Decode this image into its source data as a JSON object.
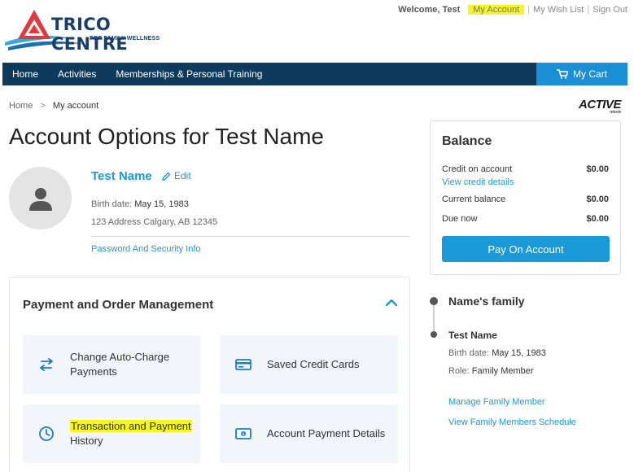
{
  "brand": {
    "name": "TRICO CENTRE",
    "tagline": "FOR FAMILY WELLNESS",
    "colors": {
      "navy": "#0e3a5c",
      "blue": "#1a9ad6",
      "red": "#e03a3e",
      "highlight": "#f5f522"
    }
  },
  "top_links": {
    "welcome": "Welcome, Test",
    "my_account": "My Account",
    "wish_list": "My Wish List",
    "sign_out": "Sign Out",
    "separator": "|"
  },
  "nav": {
    "home": "Home",
    "activities": "Activities",
    "memberships": "Memberships & Personal Training",
    "cart": "My Cart",
    "cart_icon": "cart-icon"
  },
  "breadcrumb": {
    "home": "Home",
    "separator": ">",
    "current": "My account"
  },
  "partner_logo": {
    "name": "ACTIVE",
    "sub": "network"
  },
  "page_title": "Account Options for Test Name",
  "profile": {
    "name": "Test Name",
    "edit": "Edit",
    "birth_label": "Birth date:",
    "birth_value": "May 15, 1983",
    "address": "123 Address Calgary, AB 12345",
    "password_link": "Password And Security Info"
  },
  "payment_panel": {
    "title": "Payment and Order Management",
    "tiles": [
      {
        "label": "Change Auto-Charge Payments",
        "line1": "Change Auto-Charge",
        "line2": "Payments",
        "icon": "swap-arrows-icon"
      },
      {
        "label": "Saved Credit Cards",
        "icon": "credit-card-icon"
      },
      {
        "label": "Transaction and Payment History",
        "line1": "Transaction and Payment",
        "line2": "History",
        "icon": "clock-icon"
      },
      {
        "label": "Account Payment Details",
        "icon": "money-icon"
      }
    ]
  },
  "balance": {
    "title": "Balance",
    "credit_label": "Credit on account",
    "credit_value": "$0.00",
    "credit_link": "View credit details",
    "current_label": "Current balance",
    "current_value": "$0.00",
    "due_label": "Due now",
    "due_value": "$0.00",
    "pay_button": "Pay On Account"
  },
  "family": {
    "title": "Name's family",
    "member_name": "Test Name",
    "birth_label": "Birth date:",
    "birth_value": "May 15, 1983",
    "role_label": "Role:",
    "role_value": "Family Member",
    "manage_link": "Manage Family Member",
    "schedule_link": "View Family Members Schedule"
  }
}
